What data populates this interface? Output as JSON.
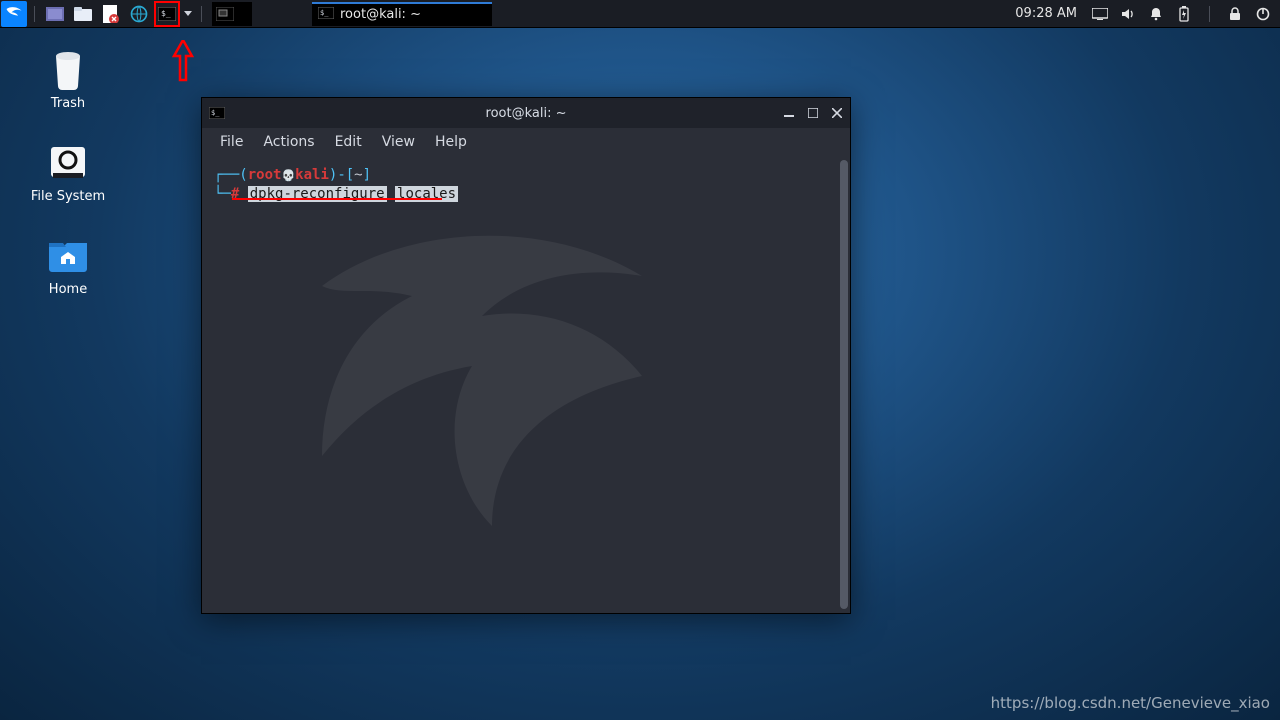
{
  "panel": {
    "taskbar_window_title": "root@kali: ~",
    "clock": "09:28 AM"
  },
  "desktop": {
    "trash": "Trash",
    "filesystem": "File System",
    "home": "Home"
  },
  "terminal": {
    "title": "root@kali: ~",
    "menu": {
      "file": "File",
      "actions": "Actions",
      "edit": "Edit",
      "view": "View",
      "help": "Help"
    },
    "prompt_user": "root",
    "prompt_host": "kali",
    "prompt_path": "~",
    "hash": "#",
    "command_part1": "dpkg-reconfigure",
    "command_part2": "locales"
  },
  "watermark": "https://blog.csdn.net/Genevieve_xiao"
}
